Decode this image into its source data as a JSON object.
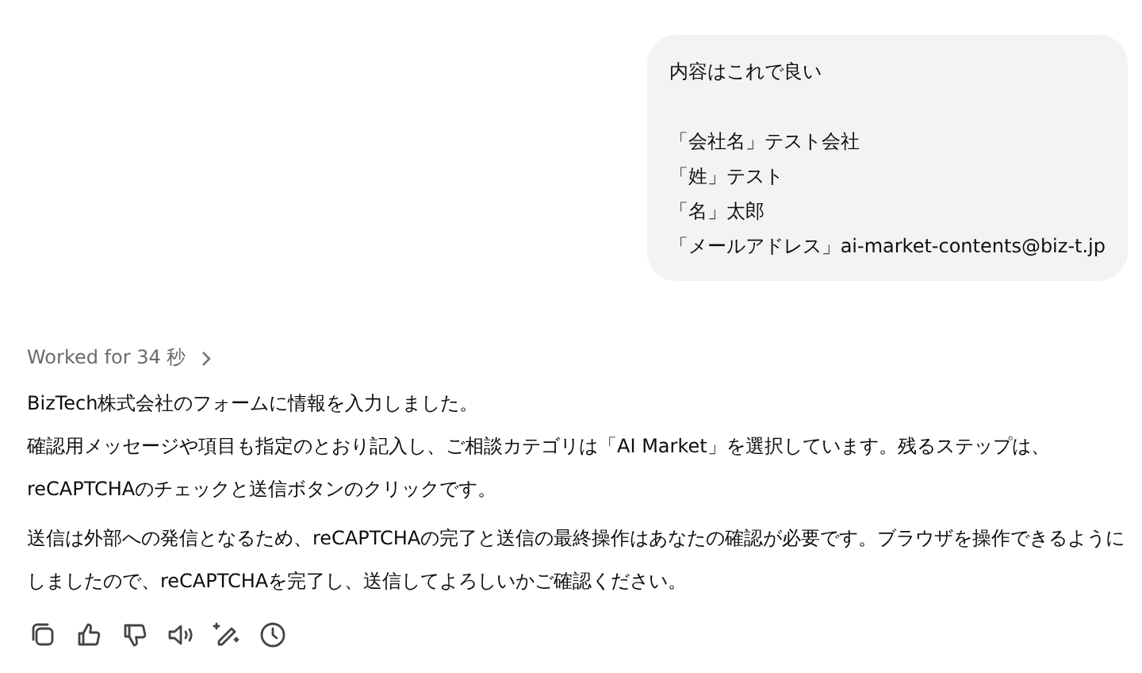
{
  "user_message": {
    "heading": "内容はこれで良い",
    "lines": [
      "「会社名」テスト会社",
      "「姓」テスト",
      "「名」太郎",
      "「メールアドレス」ai-market-contents@biz-t.jp"
    ]
  },
  "assistant_message": {
    "worked_for": "Worked for 34 秒",
    "paragraphs": [
      {
        "lines": [
          "BizTech株式会社のフォームに情報を入力しました。",
          "確認用メッセージや項目も指定のとおり記入し、ご相談カテゴリは「AI Market」を選択しています。残るステップは、reCAPTCHAのチェックと送信ボタンのクリックです。"
        ]
      },
      {
        "lines": [
          "送信は外部への発信となるため、reCAPTCHAの完了と送信の最終操作はあなたの確認が必要です。ブラウザを操作できるようにしましたので、reCAPTCHAを完了し、送信してよろしいかご確認ください。"
        ]
      }
    ],
    "actions": [
      {
        "kind": "copy"
      },
      {
        "kind": "like"
      },
      {
        "kind": "dislike"
      },
      {
        "kind": "speak"
      },
      {
        "kind": "edit"
      },
      {
        "kind": "history"
      }
    ]
  }
}
